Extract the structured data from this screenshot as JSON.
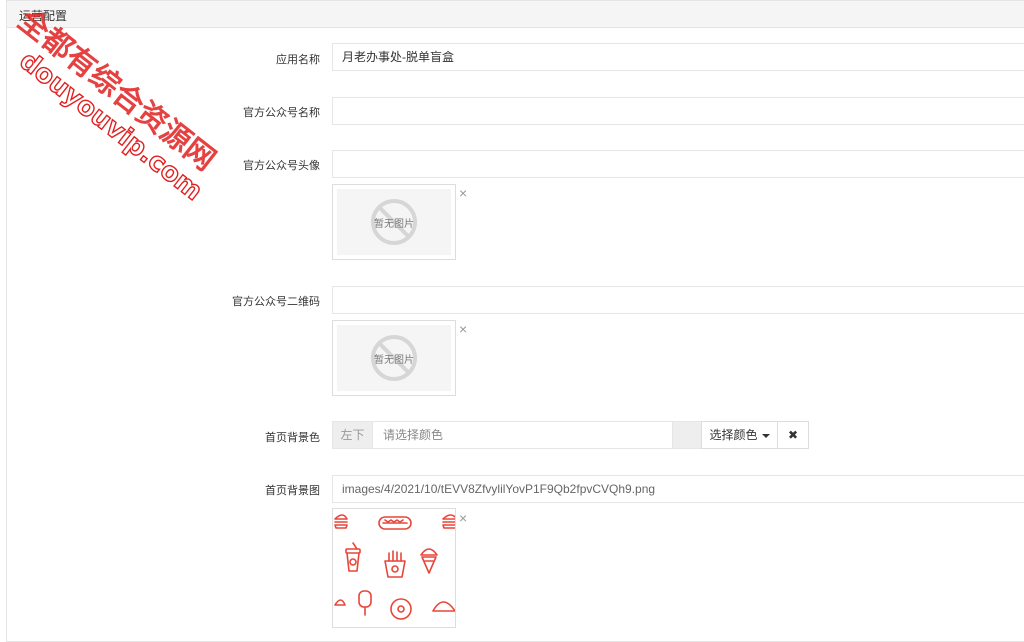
{
  "panel": {
    "title": "运营配置"
  },
  "fields": {
    "app_name": {
      "label": "应用名称",
      "value": "月老办事处-脱单盲盒"
    },
    "official_name": {
      "label": "官方公众号名称",
      "value": ""
    },
    "official_avatar": {
      "label": "官方公众号头像",
      "value": "",
      "preview_text": "暂无图片"
    },
    "official_qrcode": {
      "label": "官方公众号二维码",
      "value": "",
      "preview_text": "暂无图片"
    },
    "home_bg_color": {
      "label": "首页背景色",
      "addon": "左下",
      "placeholder": "请选择颜色",
      "pick_button": "选择颜色",
      "clear_button": "✖"
    },
    "home_bg_image": {
      "label": "首页背景图",
      "value": "images/4/2021/10/tEVV8ZfvylilYovP1F9Qb2fpvCVQh9.png"
    }
  },
  "remove_glyph": "×",
  "watermark": {
    "line1": "全都有综合资源网",
    "line2": "douyouvip.com"
  },
  "colors": {
    "accent_red": "#e8463a",
    "watermark_red": "#e02020"
  }
}
